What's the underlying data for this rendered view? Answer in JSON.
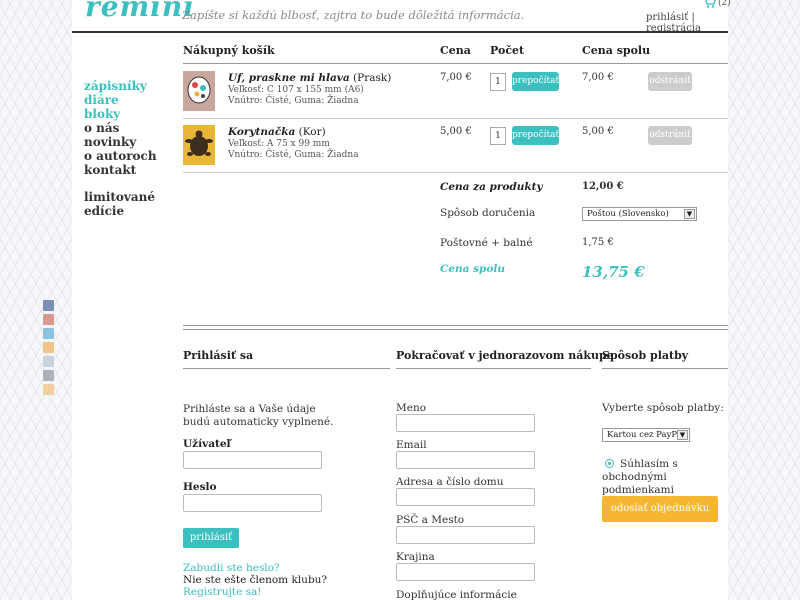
{
  "brand": {
    "logo": "remini",
    "tagline": "Zapíšte si každú blbosť, zajtra to bude dôležitá informácia."
  },
  "header": {
    "cart_count": "(2)",
    "login": "prihlásiť",
    "separator": " | ",
    "register": "registrácia"
  },
  "nav": {
    "items": [
      {
        "label": "zápisníky"
      },
      {
        "label": "diáre"
      },
      {
        "label": "bloky"
      },
      {
        "label": "o nás"
      },
      {
        "label": "novinky"
      },
      {
        "label": "o autoroch"
      },
      {
        "label": "kontakt"
      }
    ],
    "limited_1": "limitované",
    "limited_2": "edície"
  },
  "cart": {
    "headers": {
      "name": "Nákupný košík",
      "price": "Cena",
      "qty": "Počet",
      "total": "Cena spolu"
    },
    "items": [
      {
        "name": "Uf, praskne mi hlava",
        "variant": "(Prask)",
        "size": "Veľkosť: C 107 x 155 mm (A6)",
        "inside": "Vnútro: Čisté, Guma: Žiadna",
        "price": "7,00 €",
        "qty": "1",
        "recalc": "prepočítať",
        "total": "7,00 €",
        "remove": "odstrániť"
      },
      {
        "name": "Korytnačka",
        "variant": "(Kor)",
        "size": "Veľkosť: A 75 x 99 mm",
        "inside": "Vnútro: Čisté, Guma: Žiadna",
        "price": "5,00 €",
        "qty": "1",
        "recalc": "prepočítať",
        "total": "5,00 €",
        "remove": "odstrániť"
      }
    ],
    "summary": {
      "products_label": "Cena za produkty",
      "products_value": "12,00 €",
      "delivery_label": "Spôsob doručenia",
      "delivery_value": "Poštou (Slovensko)",
      "postage_label": "Poštovné + balné",
      "postage_value": "1,75 €",
      "total_label": "Cena spolu",
      "total_value": "13,75 €"
    }
  },
  "login": {
    "title": "Prihlásiť sa",
    "intro_1": "Prihláste sa a Vaše údaje",
    "intro_2": "budú automaticky vyplnené.",
    "user_label": "Užívateľ",
    "password_label": "Heslo",
    "button": "prihlásiť",
    "forgot": "Zabudli ste heslo?",
    "not_member": "Nie ste ešte členom klubu?",
    "register": "Registrujte sa!"
  },
  "guest": {
    "title": "Pokračovať v jednorazovom nákupe",
    "fields": {
      "name": "Meno",
      "email": "Email",
      "address": "Adresa a číslo domu",
      "zip_city": "PSČ a Mesto",
      "country": "Krajina",
      "extra": "Doplňujúce informácie"
    }
  },
  "payment": {
    "title": "Spôsob platby",
    "choose": "Vyberte spôsob platby:",
    "method": "Kartou cez PayPal",
    "agree_1": "Súhlasím s obchodnými",
    "agree_2": "podmienkami",
    "order_button": "odoslať objednávku"
  },
  "colors": {
    "accent": "#3bbfbf",
    "order": "#f5b731"
  }
}
